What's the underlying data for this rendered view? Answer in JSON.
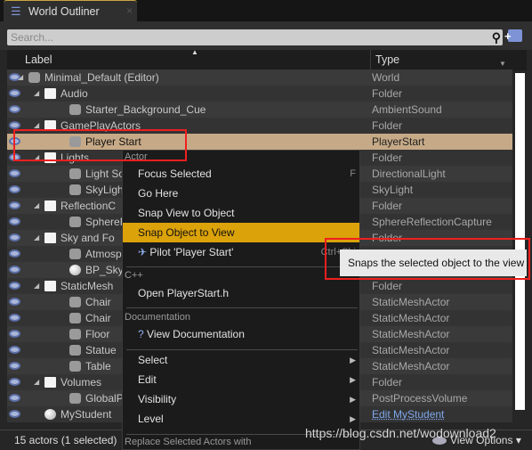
{
  "tab": {
    "title": "World Outliner",
    "close": "×"
  },
  "search": {
    "placeholder": "Search..."
  },
  "columns": {
    "label": "Label",
    "type": "Type"
  },
  "rows": [
    {
      "name": "Minimal_Default (Editor)",
      "type": "World",
      "depth": 0,
      "icon": "world-icon",
      "expand": true
    },
    {
      "name": "Audio",
      "type": "Folder",
      "depth": 1,
      "icon": "folder-icon",
      "expand": true
    },
    {
      "name": "Starter_Background_Cue",
      "type": "AmbientSound",
      "depth": 2,
      "icon": "sound-icon"
    },
    {
      "name": "GamePlayActors",
      "type": "Folder",
      "depth": 1,
      "icon": "folder-icon",
      "expand": true
    },
    {
      "name": "Player Start",
      "type": "PlayerStart",
      "depth": 2,
      "icon": "player-start-icon",
      "selected": true
    },
    {
      "name": "Lights",
      "type": "Folder",
      "depth": 1,
      "icon": "folder-icon",
      "expand": true
    },
    {
      "name": "Light Sou",
      "type": "DirectionalLight",
      "depth": 2,
      "icon": "light-icon"
    },
    {
      "name": "SkyLight",
      "type": "SkyLight",
      "depth": 2,
      "icon": "skylight-icon"
    },
    {
      "name": "ReflectionC",
      "type": "Folder",
      "depth": 1,
      "icon": "folder-icon",
      "expand": true
    },
    {
      "name": "SphereRe",
      "type": "SphereReflectionCapture",
      "depth": 2,
      "icon": "reflection-icon"
    },
    {
      "name": "Sky and Fo",
      "type": "Folder",
      "depth": 1,
      "icon": "folder-icon",
      "expand": true
    },
    {
      "name": "Atmosph",
      "type": "",
      "depth": 2,
      "icon": "atmosphere-icon"
    },
    {
      "name": "BP_Sky_S",
      "type": "",
      "depth": 2,
      "icon": "sphere-icon"
    },
    {
      "name": "StaticMesh",
      "type": "Folder",
      "depth": 1,
      "icon": "folder-icon",
      "expand": true
    },
    {
      "name": "Chair",
      "type": "StaticMeshActor",
      "depth": 2,
      "icon": "static-mesh-icon"
    },
    {
      "name": "Chair",
      "type": "StaticMeshActor",
      "depth": 2,
      "icon": "static-mesh-icon"
    },
    {
      "name": "Floor",
      "type": "StaticMeshActor",
      "depth": 2,
      "icon": "static-mesh-icon"
    },
    {
      "name": "Statue",
      "type": "StaticMeshActor",
      "depth": 2,
      "icon": "static-mesh-icon"
    },
    {
      "name": "Table",
      "type": "StaticMeshActor",
      "depth": 2,
      "icon": "static-mesh-icon"
    },
    {
      "name": "Volumes",
      "type": "Folder",
      "depth": 1,
      "icon": "folder-icon",
      "expand": true
    },
    {
      "name": "GlobalPo",
      "type": "PostProcessVolume",
      "depth": 2,
      "icon": "volume-icon"
    },
    {
      "name": "MyStudent",
      "type": "Edit MyStudent",
      "depth": 1,
      "icon": "sphere-icon",
      "link": true
    }
  ],
  "footer": {
    "count": "15 actors (1 selected)",
    "view_options": "View Options"
  },
  "menu": {
    "actor_header": "Actor",
    "focus_selected": "Focus Selected",
    "focus_shortcut": "F",
    "go_here": "Go Here",
    "snap_view": "Snap View to Object",
    "snap_object": "Snap Object to View",
    "pilot": "Pilot 'Player Start'",
    "pilot_shortcut": "Ctrl+Shi",
    "cpp_header": "C++",
    "open_header": "Open PlayerStart.h",
    "doc_header": "Documentation",
    "view_doc": "View Documentation",
    "select": "Select",
    "edit": "Edit",
    "visibility": "Visibility",
    "level": "Level",
    "replace_header": "Replace Selected Actors with"
  },
  "tooltip": "Snaps the selected object to the view",
  "watermark": "https://blog.csdn.net/wodownload2",
  "colors": {
    "selected_row": "#c6a986",
    "menu_highlight": "#dba20a",
    "annotation": "#f01f1f",
    "link": "#7ea8ec"
  }
}
